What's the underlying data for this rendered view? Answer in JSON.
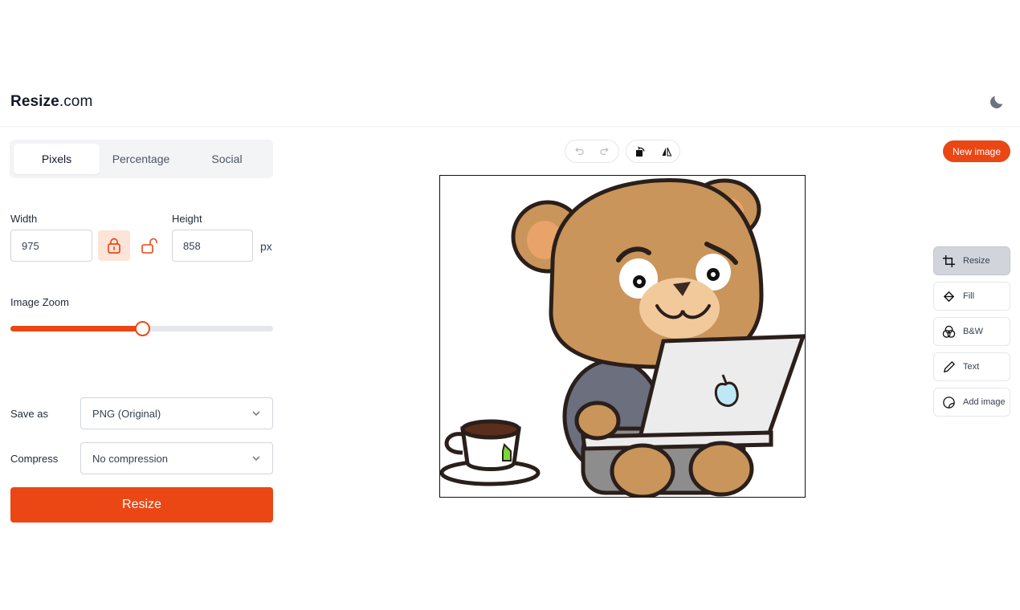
{
  "app": {
    "logo_bold": "Resize",
    "logo_light": ".com"
  },
  "tabs": [
    {
      "label": "Pixels",
      "active": true
    },
    {
      "label": "Percentage",
      "active": false
    },
    {
      "label": "Social",
      "active": false
    }
  ],
  "dimensions": {
    "width_label": "Width",
    "width_value": "975",
    "height_label": "Height",
    "height_value": "858",
    "unit": "px",
    "aspect_locked": true
  },
  "zoom": {
    "label": "Image Zoom",
    "value_percent": 50
  },
  "save_as": {
    "label": "Save as",
    "value": "PNG (Original)"
  },
  "compress": {
    "label": "Compress",
    "value": "No compression"
  },
  "resize_button": "Resize",
  "new_image_button": "New image",
  "toolbar_icons": [
    "undo-icon",
    "redo-icon",
    "rotate-icon",
    "flip-icon"
  ],
  "tools": [
    {
      "label": "Resize",
      "icon": "crop-icon",
      "active": true
    },
    {
      "label": "Fill",
      "icon": "fill-bucket-icon",
      "active": false
    },
    {
      "label": "B&W",
      "icon": "color-circles-icon",
      "active": false
    },
    {
      "label": "Text",
      "icon": "pencil-icon",
      "active": false
    },
    {
      "label": "Add image",
      "icon": "add-image-icon",
      "active": false
    }
  ],
  "colors": {
    "accent": "#ea4715",
    "accent_soft": "#fde4d9",
    "active_tool": "#d1d5db"
  }
}
